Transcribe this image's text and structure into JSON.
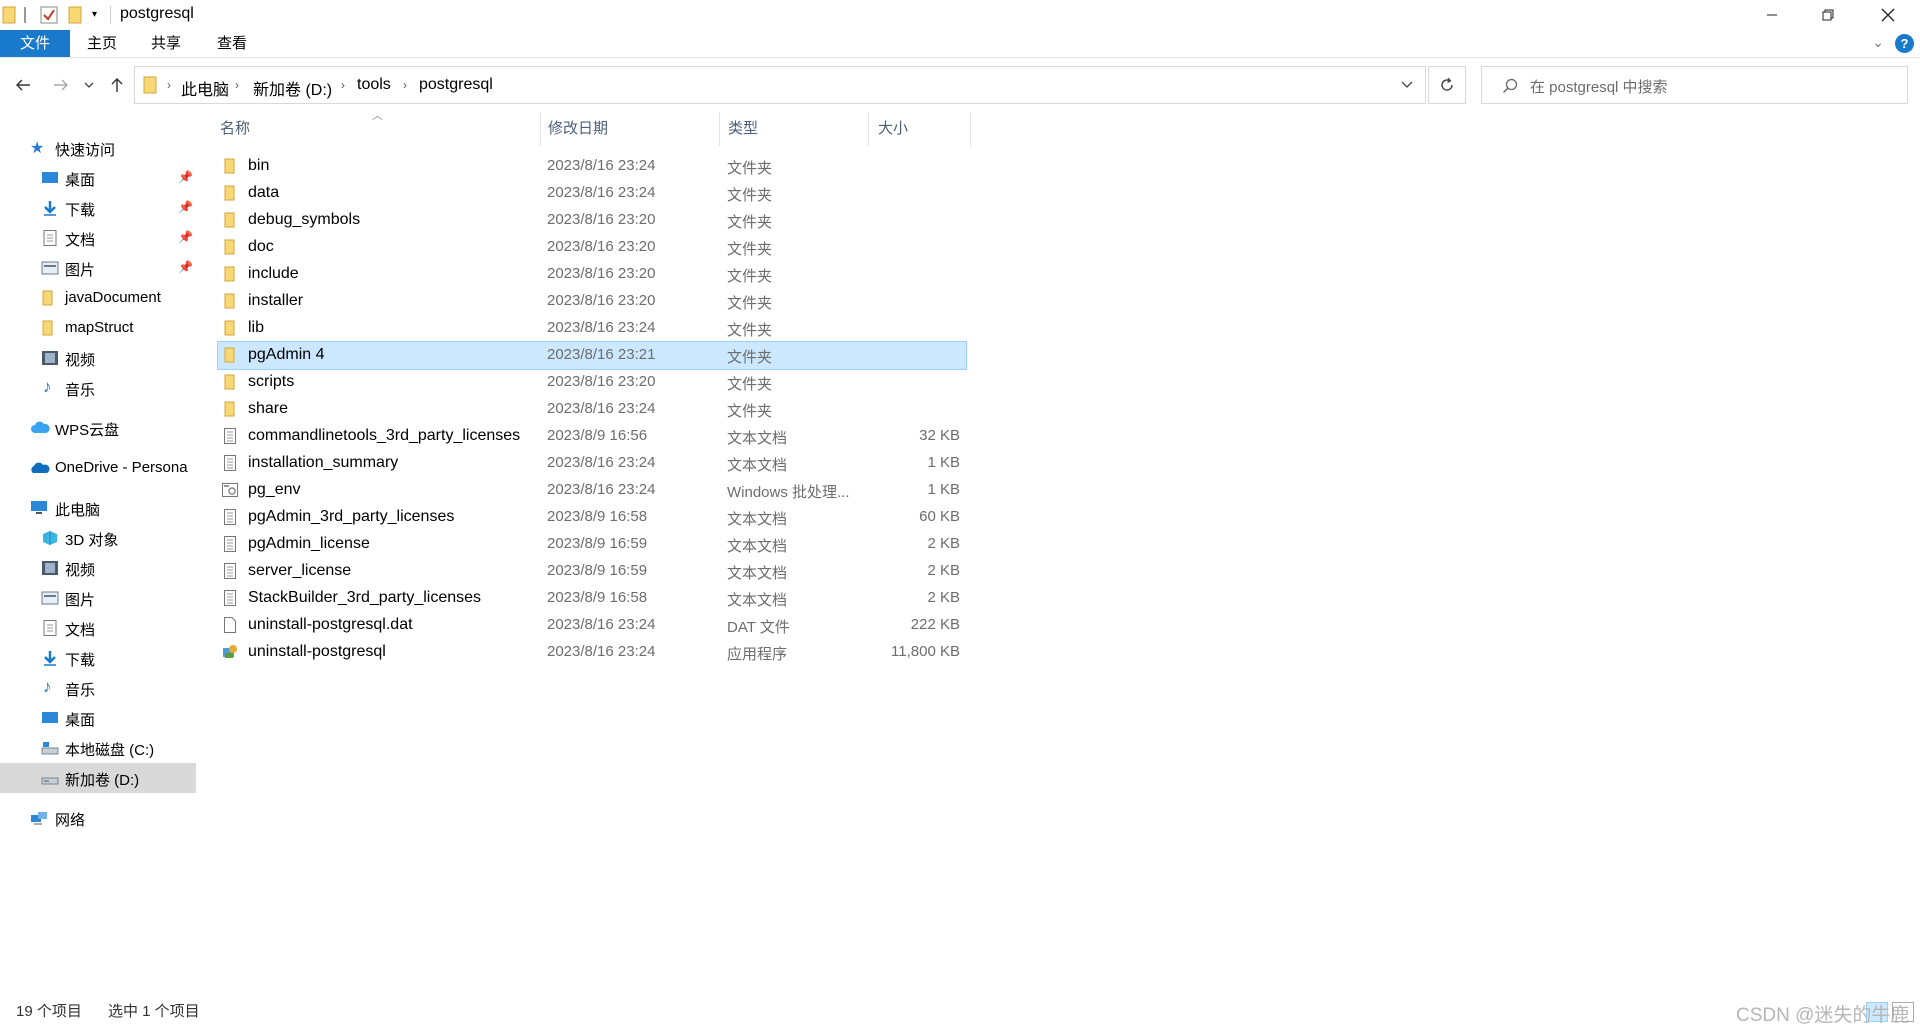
{
  "window": {
    "title": "postgresql"
  },
  "ribbon": {
    "tabs": [
      "文件",
      "主页",
      "共享",
      "查看"
    ]
  },
  "address": {
    "breadcrumbs": [
      "此电脑",
      "新加卷 (D:)",
      "tools",
      "postgresql"
    ]
  },
  "search": {
    "placeholder": "在 postgresql 中搜索"
  },
  "sidebar": {
    "items": [
      {
        "label": "快速访问",
        "icon": "star-icon",
        "pinned": false
      },
      {
        "label": "桌面",
        "icon": "desktop-icon",
        "pinned": true
      },
      {
        "label": "下载",
        "icon": "download-icon",
        "pinned": true
      },
      {
        "label": "文档",
        "icon": "document-icon",
        "pinned": true
      },
      {
        "label": "图片",
        "icon": "pictures-icon",
        "pinned": true
      },
      {
        "label": "javaDocument",
        "icon": "folder-icon",
        "pinned": false
      },
      {
        "label": "mapStruct",
        "icon": "folder-icon",
        "pinned": false
      },
      {
        "label": "视频",
        "icon": "video-icon",
        "pinned": false
      },
      {
        "label": "音乐",
        "icon": "music-icon",
        "pinned": false
      },
      {
        "label": "WPS云盘",
        "icon": "cloud-icon",
        "pinned": false
      },
      {
        "label": "OneDrive - Persona",
        "icon": "onedrive-icon",
        "pinned": false
      },
      {
        "label": "此电脑",
        "icon": "computer-icon",
        "pinned": false
      },
      {
        "label": "3D 对象",
        "icon": "3d-objects-icon",
        "pinned": false
      },
      {
        "label": "视频",
        "icon": "video-icon",
        "pinned": false
      },
      {
        "label": "图片",
        "icon": "pictures-icon",
        "pinned": false
      },
      {
        "label": "文档",
        "icon": "document-icon",
        "pinned": false
      },
      {
        "label": "下载",
        "icon": "download-icon",
        "pinned": false
      },
      {
        "label": "音乐",
        "icon": "music-icon",
        "pinned": false
      },
      {
        "label": "桌面",
        "icon": "desktop-icon",
        "pinned": false
      },
      {
        "label": "本地磁盘 (C:)",
        "icon": "drive-c-icon",
        "pinned": false
      },
      {
        "label": "新加卷 (D:)",
        "icon": "drive-icon",
        "pinned": false,
        "active": true
      },
      {
        "label": "网络",
        "icon": "network-icon",
        "pinned": false
      }
    ]
  },
  "columns": {
    "name": "名称",
    "date": "修改日期",
    "type": "类型",
    "size": "大小"
  },
  "files": [
    {
      "name": "bin",
      "date": "2023/8/16 23:24",
      "type": "文件夹",
      "size": "",
      "icon": "folder-icon"
    },
    {
      "name": "data",
      "date": "2023/8/16 23:24",
      "type": "文件夹",
      "size": "",
      "icon": "folder-icon"
    },
    {
      "name": "debug_symbols",
      "date": "2023/8/16 23:20",
      "type": "文件夹",
      "size": "",
      "icon": "folder-icon"
    },
    {
      "name": "doc",
      "date": "2023/8/16 23:20",
      "type": "文件夹",
      "size": "",
      "icon": "folder-icon"
    },
    {
      "name": "include",
      "date": "2023/8/16 23:20",
      "type": "文件夹",
      "size": "",
      "icon": "folder-icon"
    },
    {
      "name": "installer",
      "date": "2023/8/16 23:20",
      "type": "文件夹",
      "size": "",
      "icon": "folder-icon"
    },
    {
      "name": "lib",
      "date": "2023/8/16 23:24",
      "type": "文件夹",
      "size": "",
      "icon": "folder-icon"
    },
    {
      "name": "pgAdmin 4",
      "date": "2023/8/16 23:21",
      "type": "文件夹",
      "size": "",
      "icon": "folder-icon",
      "selected": true
    },
    {
      "name": "scripts",
      "date": "2023/8/16 23:20",
      "type": "文件夹",
      "size": "",
      "icon": "folder-icon"
    },
    {
      "name": "share",
      "date": "2023/8/16 23:24",
      "type": "文件夹",
      "size": "",
      "icon": "folder-icon"
    },
    {
      "name": "commandlinetools_3rd_party_licenses",
      "date": "2023/8/9 16:56",
      "type": "文本文档",
      "size": "32 KB",
      "icon": "text-file-icon"
    },
    {
      "name": "installation_summary",
      "date": "2023/8/16 23:24",
      "type": "文本文档",
      "size": "1 KB",
      "icon": "text-file-icon"
    },
    {
      "name": "pg_env",
      "date": "2023/8/16 23:24",
      "type": "Windows 批处理...",
      "size": "1 KB",
      "icon": "batch-file-icon"
    },
    {
      "name": "pgAdmin_3rd_party_licenses",
      "date": "2023/8/9 16:58",
      "type": "文本文档",
      "size": "60 KB",
      "icon": "text-file-icon"
    },
    {
      "name": "pgAdmin_license",
      "date": "2023/8/9 16:59",
      "type": "文本文档",
      "size": "2 KB",
      "icon": "text-file-icon"
    },
    {
      "name": "server_license",
      "date": "2023/8/9 16:59",
      "type": "文本文档",
      "size": "2 KB",
      "icon": "text-file-icon"
    },
    {
      "name": "StackBuilder_3rd_party_licenses",
      "date": "2023/8/9 16:58",
      "type": "文本文档",
      "size": "2 KB",
      "icon": "text-file-icon"
    },
    {
      "name": "uninstall-postgresql.dat",
      "date": "2023/8/16 23:24",
      "type": "DAT 文件",
      "size": "222 KB",
      "icon": "blank-file-icon"
    },
    {
      "name": "uninstall-postgresql",
      "date": "2023/8/16 23:24",
      "type": "应用程序",
      "size": "11,800 KB",
      "icon": "application-icon"
    }
  ],
  "status": {
    "count": "19 个项目",
    "selected": "选中 1 个项目"
  },
  "watermark": "CSDN @迷失的牛鹿",
  "colors": {
    "accent": "#1979ca",
    "selection": "#cce8ff",
    "folder": "#f8d775"
  }
}
